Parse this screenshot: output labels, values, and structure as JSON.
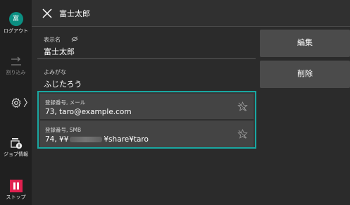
{
  "rail": {
    "logout": {
      "avatar_char": "富",
      "label": "ログアウト"
    },
    "interrupt": {
      "label": "割り込み"
    },
    "settings": {
      "chevron": "〉"
    },
    "job_info": {
      "label": "ジョブ情報"
    },
    "stop": {
      "label": "ストップ"
    }
  },
  "header": {
    "title": "富士太郎"
  },
  "fields": {
    "display_name": {
      "label": "表示名",
      "value": "富士太郎"
    },
    "reading": {
      "label": "よみがな",
      "value": "ふじたろう"
    }
  },
  "addresses": [
    {
      "label": "登録番号, メール",
      "value": "73, taro@example.com"
    },
    {
      "label": "登録番号, SMB",
      "value_prefix": "74, ¥¥",
      "value_suffix": "¥share¥taro"
    }
  ],
  "actions": {
    "edit_label": "編集",
    "delete_label": "削除"
  },
  "colors": {
    "accent": "#19a7a1",
    "stop": "#e0204f",
    "logout": "#0b8f82"
  }
}
